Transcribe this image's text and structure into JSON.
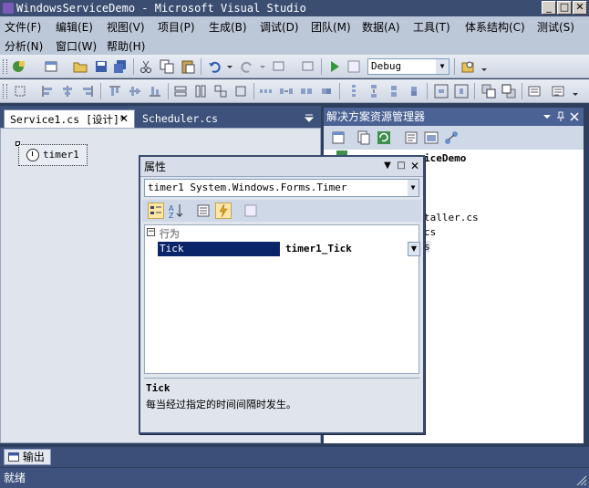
{
  "window": {
    "title": "WindowsServiceDemo - Microsoft Visual Studio",
    "controls": {
      "minimize": "_",
      "maximize": "□",
      "close": "✕"
    }
  },
  "menu": {
    "row1": [
      "文件(F)",
      "编辑(E)",
      "视图(V)",
      "项目(P)",
      "生成(B)",
      "调试(D)",
      "团队(M)",
      "数据(A)",
      "工具(T)",
      "体系结构(C)",
      "测试(S)"
    ],
    "row2": [
      "分析(N)",
      "窗口(W)",
      "帮助(H)"
    ]
  },
  "toolbar": {
    "config_combo": "Debug"
  },
  "editor": {
    "tabs": [
      {
        "label": "Service1.cs [设计]*",
        "active": true
      },
      {
        "label": "Scheduler.cs",
        "active": false
      }
    ],
    "close_glyph": "✕",
    "component_label": "timer1"
  },
  "solution_explorer": {
    "title": "解决方案资源管理器",
    "items": [
      "iceDemo",
      "taller.cs",
      "cs",
      "s"
    ]
  },
  "properties": {
    "title": "属性",
    "object": "timer1 System.Windows.Forms.Timer",
    "category": "行为",
    "category_toggle": "−",
    "row": {
      "name": "Tick",
      "value": "timer1_Tick"
    },
    "description": {
      "title": "Tick",
      "text": "每当经过指定的时间间隔时发生。"
    }
  },
  "output": {
    "label": "输出"
  },
  "status": {
    "text": "就绪"
  },
  "colors": {
    "chrome_dark": "#2e3f5e",
    "selection": "#0a246a",
    "panel": "#dfe4ed"
  }
}
